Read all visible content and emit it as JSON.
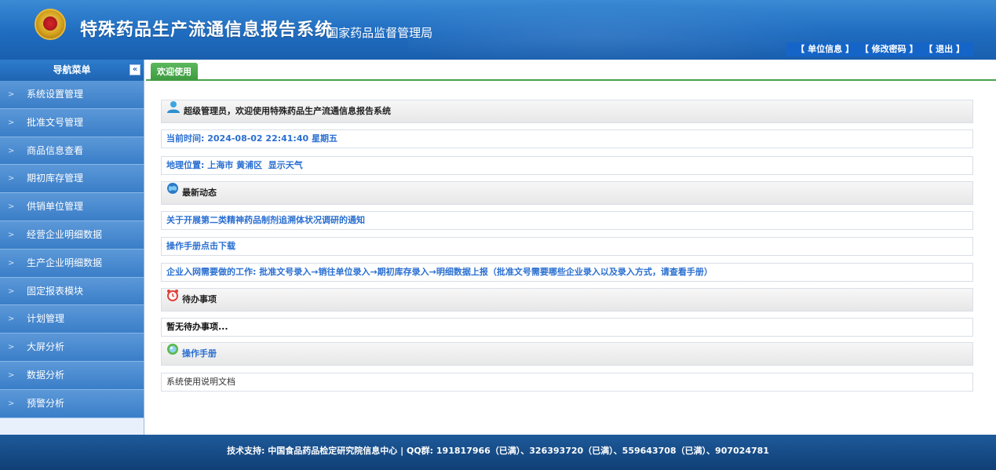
{
  "header": {
    "title": "特殊药品生产流通信息报告系统",
    "subtitle": "- 国家药品监督管理局",
    "links": [
      "【 单位信息 】",
      "【 修改密码 】",
      "【 退出 】"
    ]
  },
  "sidebar": {
    "title": "导航菜单",
    "collapse_glyph": "«",
    "items": [
      {
        "label": "系统设置管理"
      },
      {
        "label": "批准文号管理"
      },
      {
        "label": "商品信息查看"
      },
      {
        "label": "期初库存管理"
      },
      {
        "label": "供销单位管理"
      },
      {
        "label": "经营企业明细数据"
      },
      {
        "label": "生产企业明细数据"
      },
      {
        "label": "固定报表模块"
      },
      {
        "label": "计划管理"
      },
      {
        "label": "大屏分析"
      },
      {
        "label": "数据分析"
      },
      {
        "label": "预警分析"
      }
    ]
  },
  "tabs": [
    {
      "label": "欢迎使用"
    }
  ],
  "main": {
    "welcome": "超级管理员，欢迎使用特殊药品生产流通信息报告系统",
    "time": "当前时间: 2024-08-02 22:41:40 星期五",
    "location_label": "地理位置: ",
    "location_value": "上海市 黄浦区",
    "weather_link": "显示天气",
    "news_title": "最新动态",
    "news": [
      "关于开展第二类精神药品制剂追溯体状况调研的通知",
      "操作手册点击下载",
      "企业入网需要做的工作: 批准文号录入→销往单位录入→期初库存录入→明细数据上报（批准文号需要哪些企业录入以及录入方式，请查看手册）"
    ],
    "todo_title": "待办事项",
    "todo_empty": "暂无待办事项...",
    "manual_title": "操作手册",
    "manual_link": "系统使用说明文档"
  },
  "footer": {
    "text": "技术支持: 中国食品药品检定研究院信息中心 | QQ群: 191817966（已满）、326393720（已满）、559643708（已满）、907024781"
  },
  "colors": {
    "header_blue": "#1f6cc0",
    "nav_blue": "#4a8ad0",
    "tab_green": "#48a24c",
    "link_blue": "#2a6fd1",
    "footer_blue": "#124a85"
  },
  "icons": {
    "emblem": "national-emblem",
    "user": "user-icon",
    "news": "globe-icon",
    "todo": "alarm-clock-icon",
    "manual": "orb-icon",
    "nav_arrow": "chevron-right-icon"
  }
}
